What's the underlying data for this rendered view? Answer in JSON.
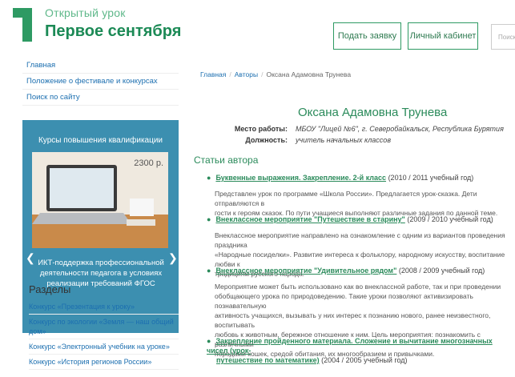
{
  "header": {
    "logo_line1": "Открытый урок",
    "logo_line2": "Первое сентября",
    "request_button": "Подать заявку",
    "cabinet_button": "Личный кабинет",
    "search_placeholder": "Поиск"
  },
  "sidebar": {
    "links": [
      "Главная",
      "Положение о фестивале и конкурсах",
      "Поиск по сайту"
    ],
    "promo": {
      "title": "Курсы повышения квалификации",
      "price": "2300 р.",
      "caption": "ИКТ-поддержка профессиональной деятельности педагога в условиях реализации требований ФГОС"
    },
    "sections_title": "Разделы",
    "sections": [
      "Конкурс «Презентация к уроку»",
      "Конкурс по экологии «Земля — наш общий дом»",
      "Конкурс «Электронный учебник на уроке»",
      "Конкурс «История регионов России»"
    ]
  },
  "main": {
    "breadcrumb": [
      "Главная",
      "Авторы",
      "Оксана Адамовна Трунева"
    ],
    "author_name": "Оксана Адамовна Трунева",
    "workplace_label": "Место работы:",
    "workplace_value": "МБОУ \"Лицей №6\", г. Северобайкальск, Республика Бурятия",
    "position_label": "Должность:",
    "position_value": "учитель начальных классов",
    "articles_title": "Статьи автора",
    "articles": [
      {
        "title": "Буквенные выражения. Закрепление. 2-й класс",
        "year": "(2010 / 2011 учебный год)",
        "lines": [
          "Представлен урок по программе «Школа России». Предлагается урок-сказка. Дети отправляются в",
          "гости к героям сказок. По пути учащиеся выполняют различные задания по данной теме."
        ]
      },
      {
        "title": "Внеклассное мероприятие \"Путешествие в старину\"",
        "year": "(2009 / 2010 учебный год)",
        "lines": [
          "Внеклассное мероприятие направлено на ознакомление с одним из вариантов проведения праздника",
          "«Народные посиделки». Развитие интереса к фольклору, народному искусству, воспитание любви к",
          "традициям русского народа."
        ]
      },
      {
        "title": "Внеклассное мероприятие \"Удивительное рядом\"",
        "year": "(2008 / 2009 учебный год)",
        "lines": [
          "Мероприятие может быть использовано как во внеклассной работе, так и при проведении",
          "обобщающего урока по природоведению. Такие уроки позволяют активизировать познавательную",
          "активность учащихся, вызывать у них интерес к познанию нового, ранее неизвестного, воспитывать",
          "любовь к животным, бережное отношение к ним. Цель мероприятия: познакомить с различными",
          "породами кошек, средой обитания, их многообразием и привычками."
        ]
      },
      {
        "title_line1": "Закрепление пройденного материала. Сложение и вычитание многозначных чисел (урок-",
        "title_line2": "путешествие по математике)",
        "year": "(2004 / 2005 учебный год)"
      }
    ]
  },
  "colors": {
    "brand_green": "#2b8b5b",
    "link_blue": "#1c6fb0",
    "promo_blue": "#3c8fb0"
  }
}
